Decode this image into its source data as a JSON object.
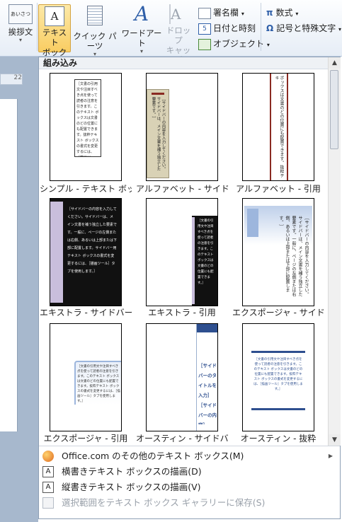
{
  "ribbon": {
    "greeting_label": "挨拶文",
    "greeting_icon_text": "あいさつ",
    "textbox_label_line1": "テキスト",
    "textbox_label_line2": "ボックス",
    "quickparts_label": "クイック パーツ",
    "wordart_label": "ワードアート",
    "dropcap_label_line1": "ドロップ",
    "dropcap_label_line2": "キャップ",
    "signature_label": "署名欄",
    "datetime_label": "日付と時刻",
    "object_label": "オブジェクト",
    "equation_label": "数式",
    "symbol_label": "記号と特殊文字"
  },
  "doc": {
    "ruler_number": "22"
  },
  "gallery": {
    "section_title": "組み込み",
    "items": [
      {
        "caption": "シンプル - テキスト ボックス",
        "sample": "［文書の引用文や注目すべき点を使って読者の注意を引きます。このテキスト ボックスは文書のどの位置にも配置できます。抜粋テキスト ボックスの書式を変更するには、［描画ツール］タブを使用します。］"
      },
      {
        "caption": "アルファベット - サイドバー",
        "sample": "［サイドバーの内容を入力してください。サイドバーは、メイン文書を補う独立した要素です。］"
      },
      {
        "caption": "アルファベット - 引用",
        "sample": "ボックスは文書のどの位置にも配置できます。抜粋テキ"
      },
      {
        "caption": "エキストラ - サイドバー",
        "sample": "［サイドバーの内容を入力してください。サイドバーは、メイン文書を補う独立した要素です。一般に、ページの左側または右側、あるいは上部または下部に配置します。サイドバー用テキスト ボックスの書式を変更するには、［描画ツール］タブを使用します。］"
      },
      {
        "caption": "エキストラ - 引用",
        "sample": "［文書の引用文や注目すべき点を使って読者の注意を引きます。このテキスト ボックスは文書のどの位置にも配置できます。］"
      },
      {
        "caption": "エクスポージャ - サイドバー",
        "sample": "［サイドバーの内容を入力してください。サイドバーは、メイン文書を補う独立した要素です。一般に、ページの左側または右側、あるいは上部または下部に配置します。］"
      },
      {
        "caption": "エクスポージャ - 引用",
        "sample": "［文書の引用文や注目すべき点を使って読者の注意を引きます。このテキスト ボックスは文書のどの位置にも配置できます。抜粋テキスト ボックスの書式を変更するには、［描画ツール］タブを使用します。］"
      },
      {
        "caption": "オースティン - サイドバー",
        "sample": "［サイドバーのタイトルを入力］［サイドバーの内容］"
      },
      {
        "caption": "オースティン - 抜粋",
        "sample": "［文書の引用文や注目すべき点を使って読者の注意を引きます。このテキスト ボックスは文書のどの位置にも配置できます。抜粋テキスト ボックスの書式を変更するには、［描画ツール］タブを使用します。］"
      }
    ]
  },
  "menu": {
    "more_label": "Office.com のその他のテキスト ボックス(M)",
    "horizontal_label": "横書きテキスト ボックスの描画(D)",
    "vertical_label": "縦書きテキスト ボックスの描画(V)",
    "save_label": "選択範囲をテキスト ボックス ギャラリーに保存(S)"
  },
  "colors": {
    "accent": "#f9cd62",
    "austin_blue": "#2e4f8f",
    "expo_blue": "#9db6dd",
    "alphabet_red": "#8a2a22"
  }
}
